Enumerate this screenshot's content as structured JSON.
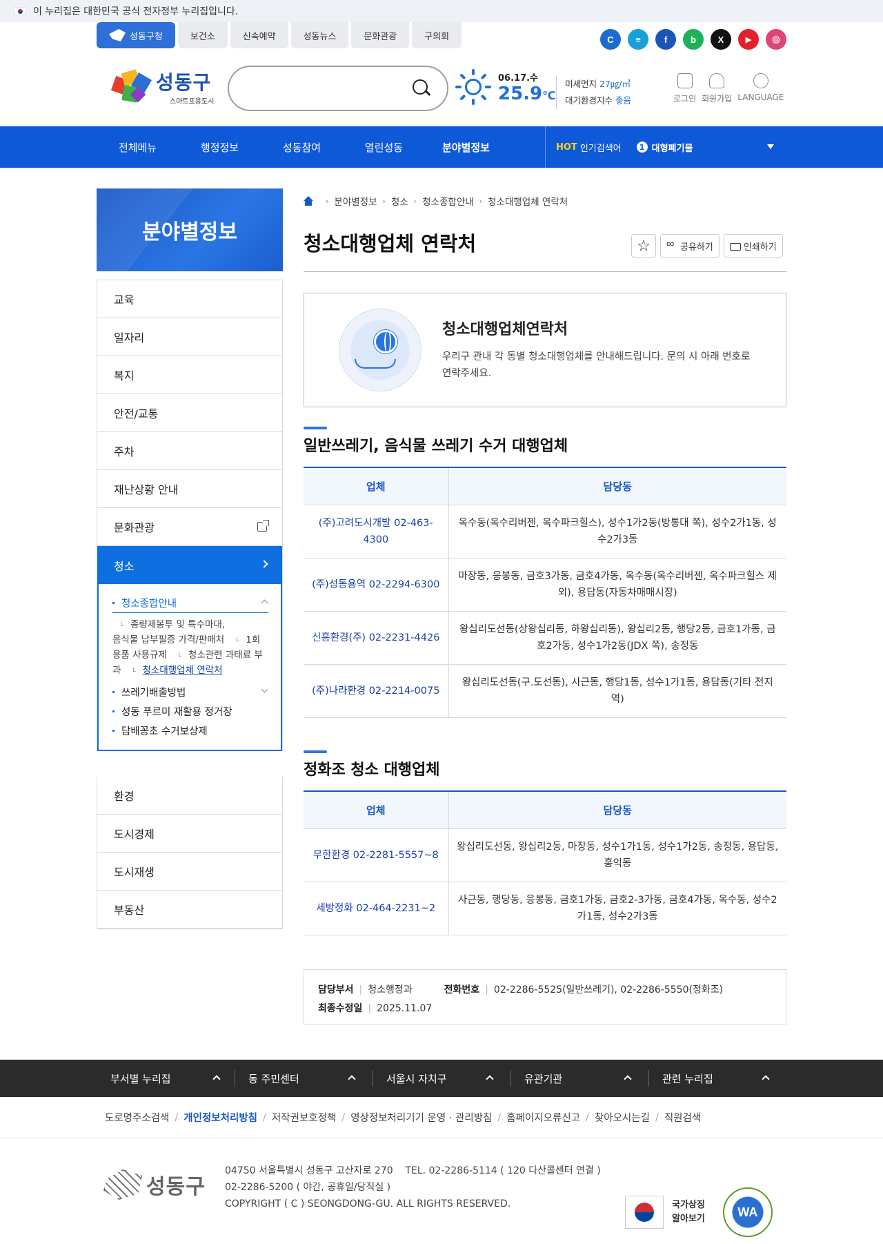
{
  "gov_banner": "이 누리집은 대한민국 공식 전자정부 누리집입니다.",
  "site_tabs": [
    "성동구청",
    "보건소",
    "신속예약",
    "성동뉴스",
    "문화관광",
    "구의회"
  ],
  "socials": [
    {
      "name": "refresh-icon",
      "glyph": "C",
      "color": "#1d6bd0"
    },
    {
      "name": "chat-icon",
      "glyph": "≡",
      "color": "#1aa0d8"
    },
    {
      "name": "facebook-icon",
      "glyph": "f",
      "color": "#1a55b8"
    },
    {
      "name": "blog-icon",
      "glyph": "b",
      "color": "#1bb25a"
    },
    {
      "name": "x-icon",
      "glyph": "X",
      "color": "#111111"
    },
    {
      "name": "youtube-icon",
      "glyph": "▶",
      "color": "#e5202a"
    },
    {
      "name": "instagram-icon",
      "glyph": "◎",
      "color": "#e0457a"
    }
  ],
  "logo": {
    "main": "성동구",
    "sub": "스마트포용도시"
  },
  "search": {
    "placeholder": ""
  },
  "weather": {
    "date": "06.17.수",
    "temp": "25.9",
    "unit": "℃"
  },
  "air": {
    "dust_label": "미세먼지",
    "dust_value": "27㎍/㎥",
    "index_label": "대기환경지수",
    "index_value": "좋음"
  },
  "util": [
    "로그인",
    "회원가입",
    "LANGUAGE"
  ],
  "gnb": {
    "items": [
      "전체메뉴",
      "행정정보",
      "성동참여",
      "열린성동",
      "분야별정보"
    ],
    "active": 4
  },
  "hot": {
    "label": "HOT",
    "text": "인기검색어",
    "rank": "1",
    "keyword": "대형폐기물"
  },
  "lnb": {
    "title": "분야별정보",
    "items": [
      "교육",
      "일자리",
      "복지",
      "안전/교통",
      "주차",
      "재난상황 안내",
      "문화관광",
      "청소"
    ],
    "active": "청소",
    "sub": {
      "open": "청소종합안내",
      "children": [
        "종량제봉투 및 특수마대,\n음식물 납부필증 가격/판매처",
        "1회용품 사용규제",
        "청소관련 과태료 부과",
        "청소대행업체 연락처"
      ],
      "others": [
        "쓰레기배출방법",
        "성동 푸르미 재활용 정거장",
        "담배꽁초 수거보상제"
      ]
    },
    "items_after": [
      "환경",
      "도시경제",
      "도시재생",
      "부동산"
    ]
  },
  "breadcrumb": [
    "분야별정보",
    "청소",
    "청소종합안내",
    "청소대행업체 연락처"
  ],
  "page_title": "청소대행업체 연락처",
  "actions": {
    "share": "공유하기",
    "print": "인쇄하기"
  },
  "intro": {
    "title": "청소대행업체연락처",
    "desc": "우리구 관내 각 동별 청소대행업체를 안내해드립니다. 문의 시 아래 번호로 연락주세요."
  },
  "section1": {
    "title": "일반쓰레기, 음식물 쓰레기 수거 대행업체",
    "headers": [
      "업체",
      "담당동"
    ],
    "rows": [
      [
        "(주)고려도시개발 02-463-4300",
        "옥수동(옥수리버젠, 옥수파크힐스), 성수1가2동(방통대 쪽), 성수2가1동, 성수2가3동"
      ],
      [
        "(주)성동용역 02-2294-6300",
        "마장동, 응봉동, 금호3가동, 금호4가동, 옥수동(옥수리버젠, 옥수파크힐스 제외), 용답동(자동차매매시장)"
      ],
      [
        "신흥환경(주) 02-2231-4426",
        "왕십리도선동(상왕십리동, 하왕십리동), 왕십리2동, 행당2동, 금호1가동, 금호2가동, 성수1가2동(JDX 쪽), 송정동"
      ],
      [
        "(주)나라환경 02-2214-0075",
        "왕십리도선동(구.도선동), 사근동, 행당1동, 성수1가1동, 용답동(기타 전지역)"
      ]
    ]
  },
  "section2": {
    "title": "정화조 청소 대행업체",
    "headers": [
      "업체",
      "담당동"
    ],
    "rows": [
      [
        "무한환경 02-2281-5557~8",
        "왕십리도선동, 왕십리2동, 마장동, 성수1가1동, 성수1가2동, 송정동, 용답동, 홍익동"
      ],
      [
        "세방정화 02-464-2231~2",
        "사근동, 행당동, 응봉동, 금호1가동, 금호2-3가동, 금호4가동, 옥수동, 성수2가1동, 성수2가3동"
      ]
    ]
  },
  "manager": {
    "dept_label": "담당부서",
    "dept": "청소행정과",
    "tel_label": "전화번호",
    "tel": "02-2286-5525(일반쓰레기), 02-2286-5550(정화조)",
    "updated_label": "최종수정일",
    "updated": "2025.11.07"
  },
  "footer_links": [
    "부서별 누리집",
    "동 주민센터",
    "서울시 자치구",
    "유관기관",
    "관련 누리집"
  ],
  "policy": [
    "도로명주소검색",
    "개인정보처리방침",
    "저작권보호정책",
    "영상정보처리기기 운영 · 관리방침",
    "홈페이지오류신고",
    "찾아오시는길",
    "직원검색"
  ],
  "footer": {
    "logo": "성동구",
    "line1": "04750 서울특별시 성동구 고산자로 270    TEL. 02-2286-5114 ( 120 다산콜센터 연결 )",
    "line2": "02-2286-5200 ( 야간, 공휴일/당직실 )",
    "line3": "COPYRIGHT ( C ) SEONGDONG-GU. ALL RIGHTS RESERVED.",
    "emblem_text": "국가상징\n알아보기",
    "wa": "WA"
  }
}
